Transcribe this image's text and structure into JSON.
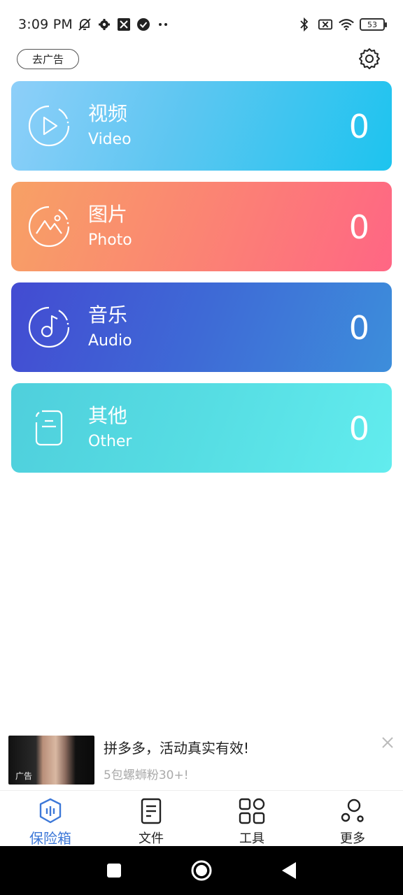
{
  "status_bar": {
    "time": "3:09 PM",
    "battery": "53",
    "icons_left": [
      "mute-bell-icon",
      "gear-icon",
      "app-icon",
      "check-circle-icon",
      "more-dots-icon"
    ],
    "icons_right": [
      "bluetooth-icon",
      "no-sim-icon",
      "wifi-icon",
      "battery-icon"
    ]
  },
  "topbar": {
    "remove_ads_label": "去广告",
    "settings_icon": "gear-icon"
  },
  "categories": [
    {
      "title": "视频",
      "subtitle": "Video",
      "count": "0",
      "icon": "play-icon",
      "gradient": [
        "#8ecff9",
        "#1dc4ef"
      ]
    },
    {
      "title": "图片",
      "subtitle": "Photo",
      "count": "0",
      "icon": "mountain-icon",
      "gradient": [
        "#f7a165",
        "#ff6684"
      ]
    },
    {
      "title": "音乐",
      "subtitle": "Audio",
      "count": "0",
      "icon": "music-note-icon",
      "gradient": [
        "#434bd2",
        "#3d8edb"
      ]
    },
    {
      "title": "其他",
      "subtitle": "Other",
      "count": "0",
      "icon": "document-icon",
      "gradient": [
        "#4fcfdc",
        "#62ecee"
      ]
    }
  ],
  "ad": {
    "title": "拼多多，活动真实有效!",
    "description": "5包螺蛳粉30+!",
    "thumb_label": "广告"
  },
  "bottom_nav": [
    {
      "label": "保险箱",
      "icon": "safe-icon",
      "active": true
    },
    {
      "label": "文件",
      "icon": "file-icon",
      "active": false
    },
    {
      "label": "工具",
      "icon": "grid-icon",
      "active": false
    },
    {
      "label": "更多",
      "icon": "more-icon",
      "active": false
    }
  ],
  "colors": {
    "accent": "#3d78d8"
  }
}
